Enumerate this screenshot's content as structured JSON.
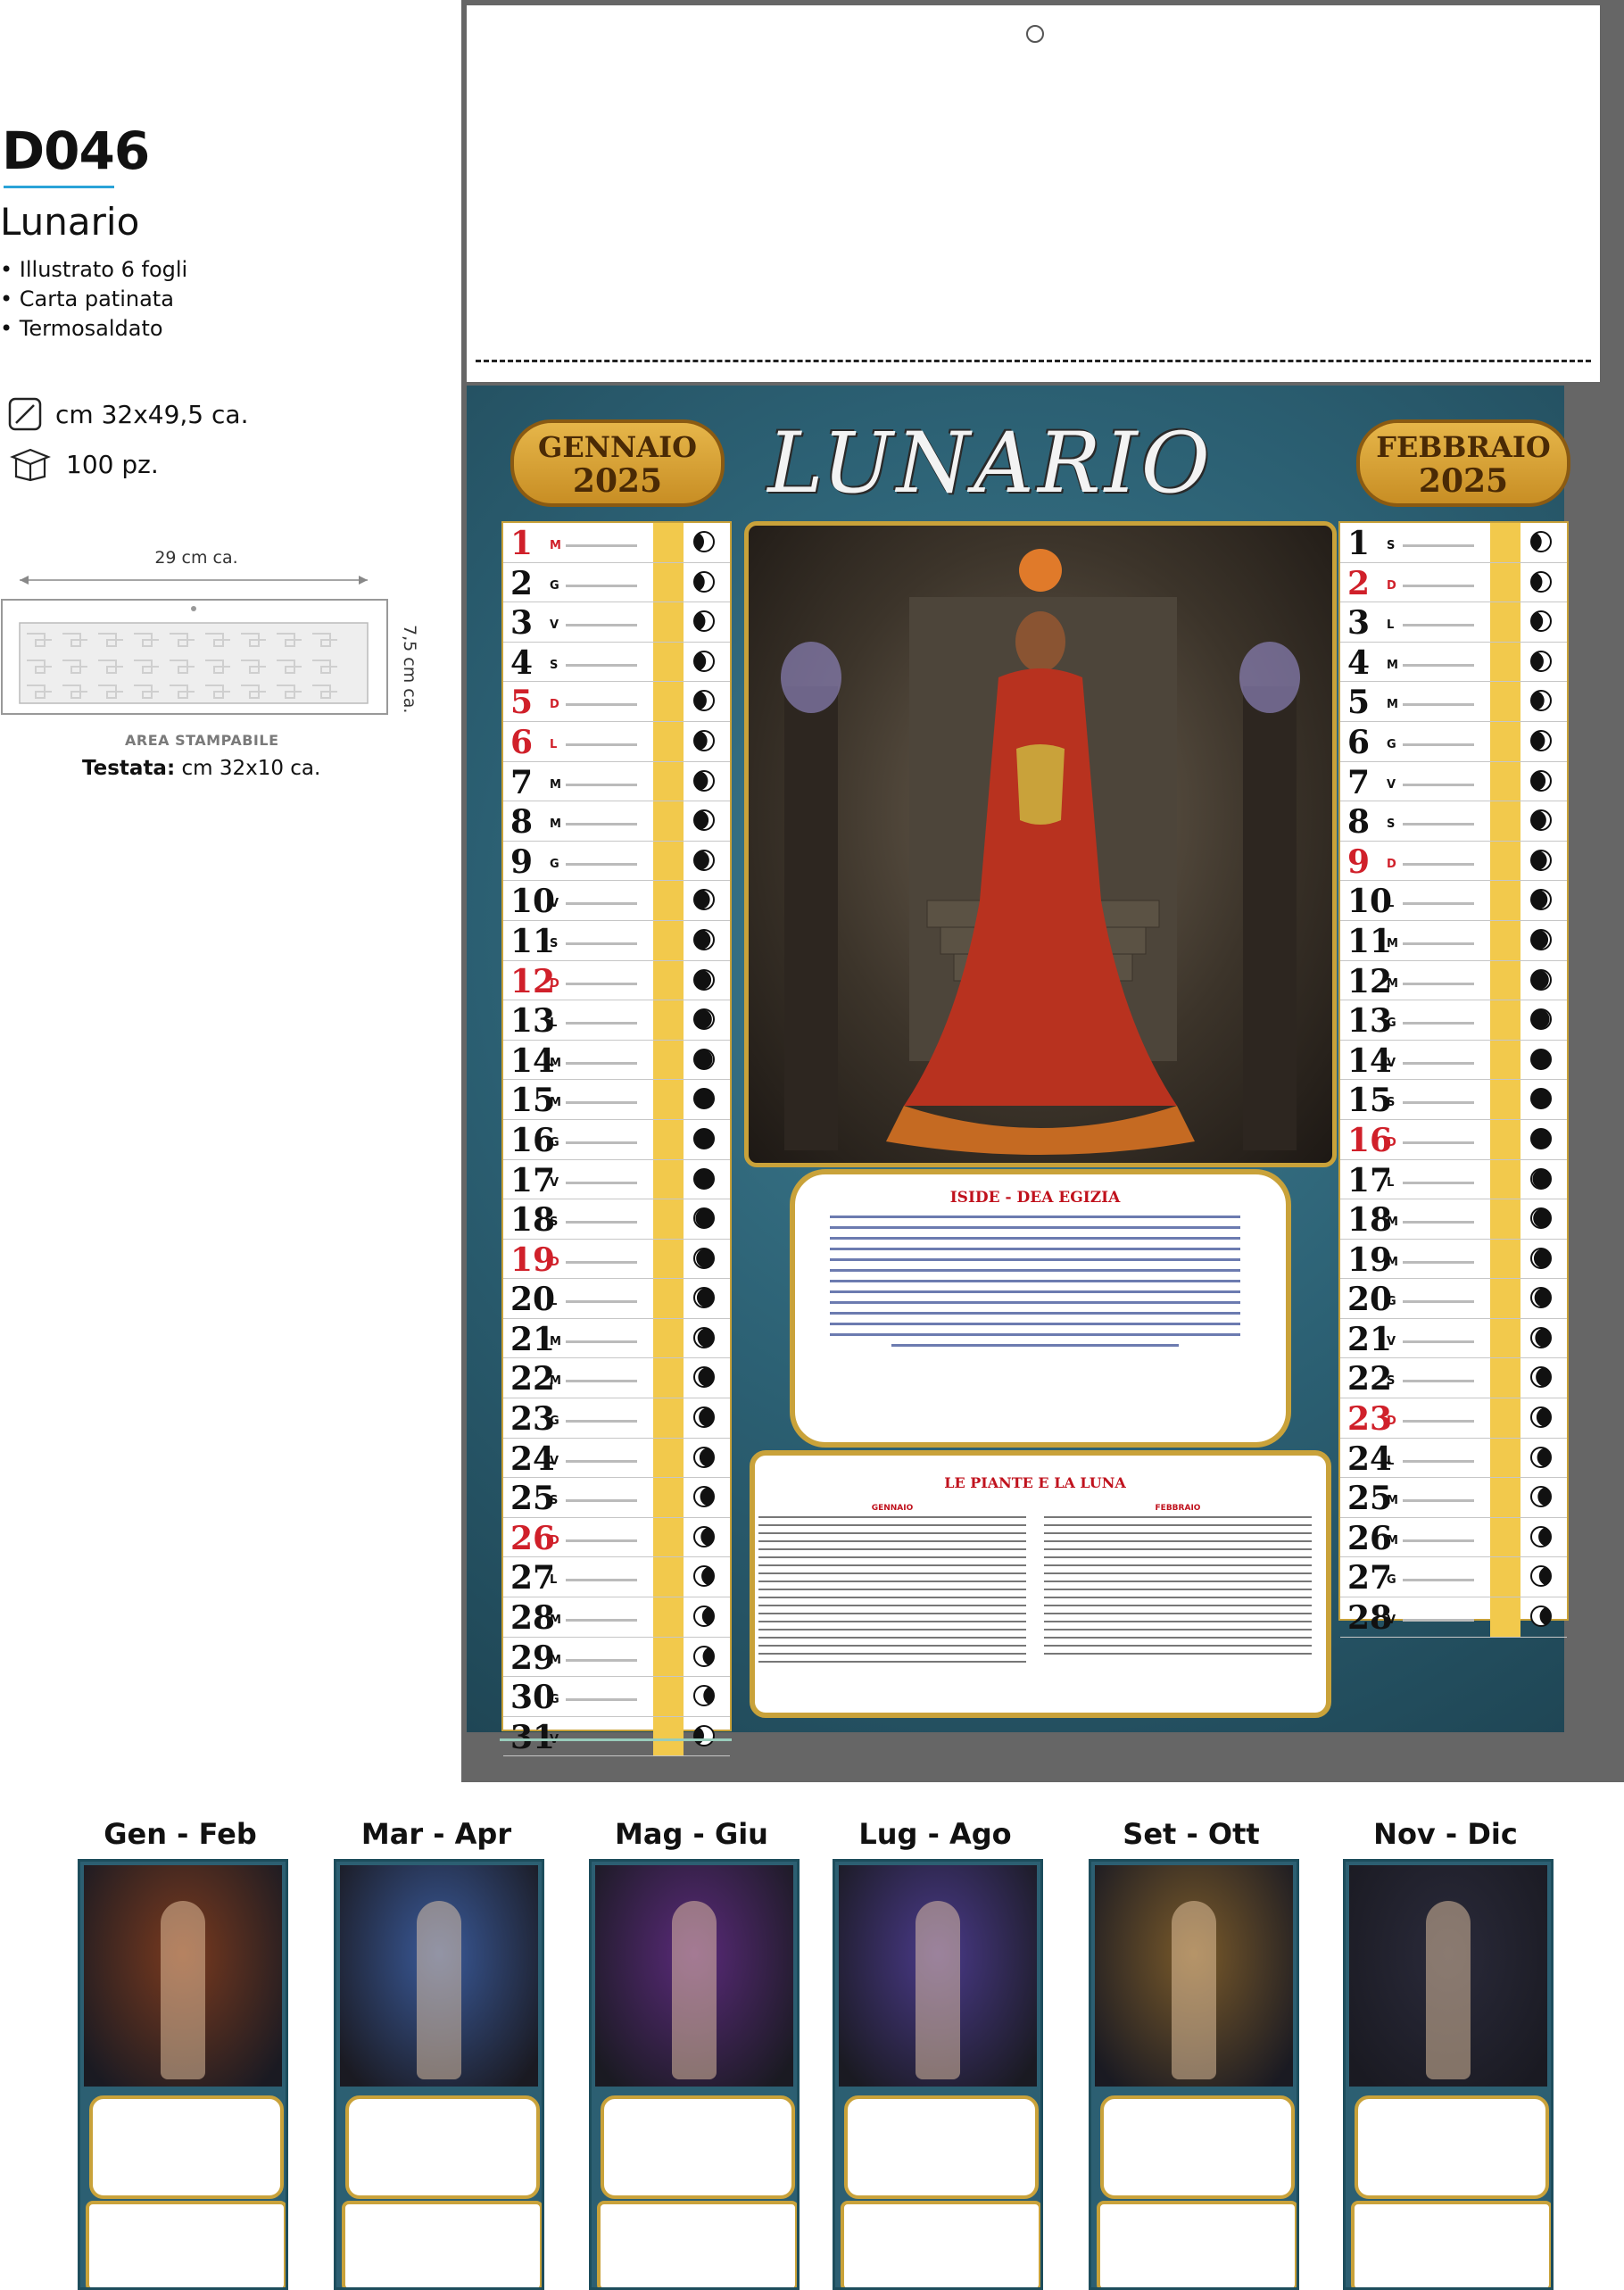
{
  "product": {
    "code": "D046",
    "name": "Lunario",
    "features": [
      "• Illustrato 6 fogli",
      "• Carta patinata",
      "• Termosaldato"
    ],
    "size": "cm 32x49,5 ca.",
    "quantity": "100 pz.",
    "size_icon": "ruler-diagonal-icon",
    "quantity_icon": "box-icon"
  },
  "header_area": {
    "width_label": "29 cm ca.",
    "height_label": "7,5 cm ca.",
    "area_label": "AREA STAMPABILE",
    "testata_label": "Testata:",
    "testata_value": "cm 32x10 ca."
  },
  "calendar": {
    "title": "LUNARIO",
    "left_month": {
      "name": "GENNAIO",
      "year": "2025"
    },
    "right_month": {
      "name": "FEBBRAIO",
      "year": "2025"
    },
    "text_box_title": "ISIDE - DEA EGIZIA",
    "plant_box_title": "LE PIANTE E LA LUNA",
    "plant_box_cols": [
      "GENNAIO",
      "FEBBRAIO"
    ],
    "colors": {
      "panel": "#2c5f72",
      "gold": "#c9a23a",
      "sunday_red": "#d0202a"
    },
    "january_days": [
      {
        "n": "1",
        "w": "M",
        "red": true
      },
      {
        "n": "2",
        "w": "G"
      },
      {
        "n": "3",
        "w": "V"
      },
      {
        "n": "4",
        "w": "S"
      },
      {
        "n": "5",
        "w": "D",
        "red": true
      },
      {
        "n": "6",
        "w": "L",
        "red": true
      },
      {
        "n": "7",
        "w": "M"
      },
      {
        "n": "8",
        "w": "M"
      },
      {
        "n": "9",
        "w": "G"
      },
      {
        "n": "10",
        "w": "V"
      },
      {
        "n": "11",
        "w": "S"
      },
      {
        "n": "12",
        "w": "D",
        "red": true
      },
      {
        "n": "13",
        "w": "L"
      },
      {
        "n": "14",
        "w": "M"
      },
      {
        "n": "15",
        "w": "M"
      },
      {
        "n": "16",
        "w": "G"
      },
      {
        "n": "17",
        "w": "V"
      },
      {
        "n": "18",
        "w": "S"
      },
      {
        "n": "19",
        "w": "D",
        "red": true
      },
      {
        "n": "20",
        "w": "L"
      },
      {
        "n": "21",
        "w": "M"
      },
      {
        "n": "22",
        "w": "M"
      },
      {
        "n": "23",
        "w": "G"
      },
      {
        "n": "24",
        "w": "V"
      },
      {
        "n": "25",
        "w": "S"
      },
      {
        "n": "26",
        "w": "D",
        "red": true
      },
      {
        "n": "27",
        "w": "L"
      },
      {
        "n": "28",
        "w": "M"
      },
      {
        "n": "29",
        "w": "M"
      },
      {
        "n": "30",
        "w": "G"
      },
      {
        "n": "31",
        "w": "V"
      }
    ],
    "february_days": [
      {
        "n": "1",
        "w": "S"
      },
      {
        "n": "2",
        "w": "D",
        "red": true
      },
      {
        "n": "3",
        "w": "L"
      },
      {
        "n": "4",
        "w": "M"
      },
      {
        "n": "5",
        "w": "M"
      },
      {
        "n": "6",
        "w": "G"
      },
      {
        "n": "7",
        "w": "V"
      },
      {
        "n": "8",
        "w": "S"
      },
      {
        "n": "9",
        "w": "D",
        "red": true
      },
      {
        "n": "10",
        "w": "L"
      },
      {
        "n": "11",
        "w": "M"
      },
      {
        "n": "12",
        "w": "M"
      },
      {
        "n": "13",
        "w": "G"
      },
      {
        "n": "14",
        "w": "V"
      },
      {
        "n": "15",
        "w": "S"
      },
      {
        "n": "16",
        "w": "D",
        "red": true
      },
      {
        "n": "17",
        "w": "L"
      },
      {
        "n": "18",
        "w": "M"
      },
      {
        "n": "19",
        "w": "M"
      },
      {
        "n": "20",
        "w": "G"
      },
      {
        "n": "21",
        "w": "V"
      },
      {
        "n": "22",
        "w": "S"
      },
      {
        "n": "23",
        "w": "D",
        "red": true
      },
      {
        "n": "24",
        "w": "L"
      },
      {
        "n": "25",
        "w": "M"
      },
      {
        "n": "26",
        "w": "M"
      },
      {
        "n": "27",
        "w": "G"
      },
      {
        "n": "28",
        "w": "V"
      }
    ]
  },
  "thumbnails": [
    {
      "label": "Gen - Feb",
      "color": "#7a3a1e"
    },
    {
      "label": "Mar - Apr",
      "color": "#3a5a9a"
    },
    {
      "label": "Mag - Giu",
      "color": "#5a2a7a"
    },
    {
      "label": "Lug - Ago",
      "color": "#4a3a8a"
    },
    {
      "label": "Set - Ott",
      "color": "#7a5a2a"
    },
    {
      "label": "Nov - Dic",
      "color": "#2a2a3a"
    }
  ]
}
